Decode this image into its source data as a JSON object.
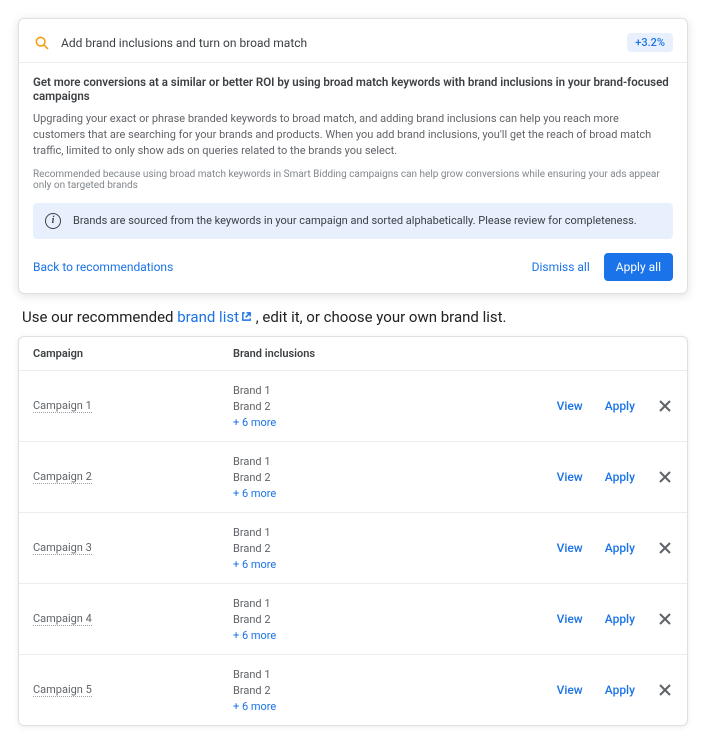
{
  "header": {
    "title": "Add brand inclusions and turn on broad match",
    "uplift": "+3.2%"
  },
  "headline": "Get more conversions at a similar or better ROI by using broad match keywords with brand inclusions in your brand-focused campaigns",
  "body": "Upgrading your exact or phrase branded keywords to broad match, and adding brand inclusions can help you reach more customers that are searching for your brands and products. When you add brand inclusions, you'll get the reach of broad match traffic, limited to only show ads on queries related to the brands you select.",
  "reason": "Recommended because using broad match keywords in Smart Bidding campaigns can help grow conversions while ensuring your ads appear only on targeted brands",
  "info_banner": "Brands are sourced from the keywords in your campaign and sorted alphabetically. Please review for completeness.",
  "footer": {
    "back": "Back to recommendations",
    "dismiss": "Dismiss all",
    "apply": "Apply all"
  },
  "instruction": {
    "pre": "Use our recommended ",
    "link": "brand list",
    "post": " , edit it, or choose your own brand list."
  },
  "table": {
    "headers": {
      "campaign": "Campaign",
      "brands": "Brand inclusions"
    },
    "actions": {
      "view": "View",
      "apply": "Apply"
    },
    "rows": [
      {
        "campaign": "Campaign 1",
        "brand1": "Brand 1",
        "brand2": "Brand 2",
        "more": "+ 6 more"
      },
      {
        "campaign": "Campaign 2",
        "brand1": "Brand 1",
        "brand2": "Brand 2",
        "more": "+ 6 more"
      },
      {
        "campaign": "Campaign 3",
        "brand1": "Brand 1",
        "brand2": "Brand 2",
        "more": "+ 6 more"
      },
      {
        "campaign": "Campaign 4",
        "brand1": "Brand 1",
        "brand2": "Brand 2",
        "more": "+ 6 more"
      },
      {
        "campaign": "Campaign 5",
        "brand1": "Brand 1",
        "brand2": "Brand 2",
        "more": "+ 6 more"
      }
    ]
  }
}
